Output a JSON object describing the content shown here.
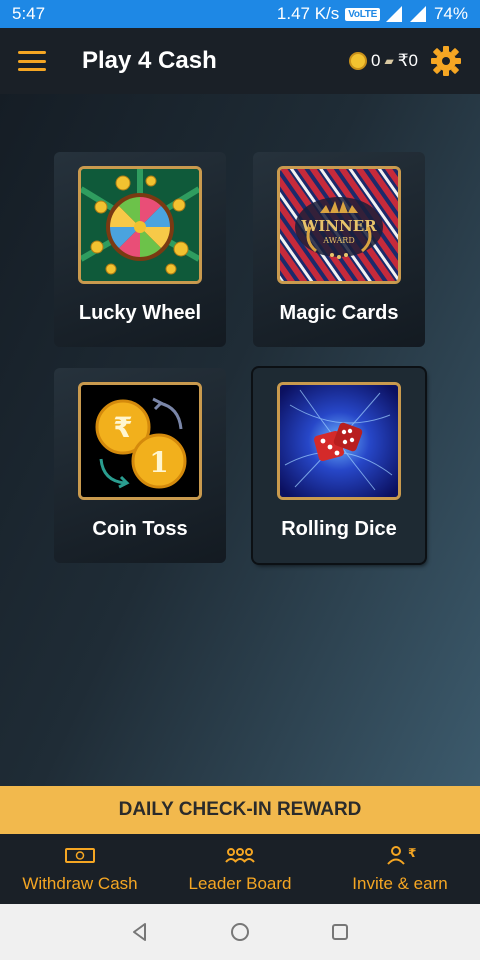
{
  "status_bar": {
    "time": "5:47",
    "network_speed": "1.47 K/s",
    "volte": "VoLTE",
    "battery": "74%"
  },
  "app_bar": {
    "title": "Play 4 Cash",
    "coins": "0",
    "cash": "₹0",
    "menu_icon": "hamburger-icon",
    "settings_icon": "gear-icon"
  },
  "games": [
    {
      "label": "Lucky Wheel",
      "image": "lucky-wheel-image"
    },
    {
      "label": "Magic Cards",
      "image": "magic-cards-image",
      "image_text": "WINNER",
      "image_subtext": "AWARD"
    },
    {
      "label": "Coin Toss",
      "image": "coin-toss-image",
      "coin_symbols": [
        "₹",
        "1"
      ]
    },
    {
      "label": "Rolling Dice",
      "image": "rolling-dice-image"
    }
  ],
  "checkin": {
    "label": "DAILY CHECK-IN REWARD"
  },
  "bottom_nav": [
    {
      "label": "Withdraw Cash",
      "icon": "cash-note-icon"
    },
    {
      "label": "Leader Board",
      "icon": "group-icon"
    },
    {
      "label": "Invite & earn",
      "icon": "add-user-rupee-icon"
    }
  ],
  "colors": {
    "accent": "#f5a623",
    "checkin_bg": "#f2b94d",
    "status_bar": "#1e88e5",
    "frame_gold": "#c99a4e"
  }
}
